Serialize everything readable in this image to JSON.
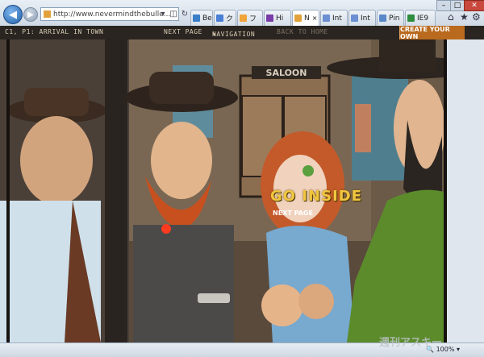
{
  "browser": {
    "address": "http://www.nevermindthebulle...",
    "tabs": [
      {
        "label": "Be",
        "color": "#3a7dc9"
      },
      {
        "label": "ク",
        "color": "#4a7fd6"
      },
      {
        "label": "フ",
        "color": "#f0a43a"
      },
      {
        "label": "Hi",
        "color": "#7a3ca8"
      },
      {
        "label": "N",
        "color": "#e2a23b",
        "active": true
      },
      {
        "label": "Int",
        "color": "#6b8fd2"
      },
      {
        "label": "Int",
        "color": "#6b8fd2"
      },
      {
        "label": "Pin",
        "color": "#5b88c8"
      },
      {
        "label": "IE9",
        "color": "#2f8d3e"
      }
    ],
    "zoom": "100%"
  },
  "site": {
    "chapter": "C1, P1: ARRIVAL IN TOWN",
    "nav_next": "NEXT PAGE",
    "nav_navigation": "NAVIGATION",
    "nav_back": "BACK TO HOME",
    "create": "CREATE YOUR OWN"
  },
  "comic": {
    "sign": "SALOON",
    "overlay": "GO INSIDE",
    "hint": "NEXT PAGE"
  },
  "watermark": "週刊アスキー"
}
